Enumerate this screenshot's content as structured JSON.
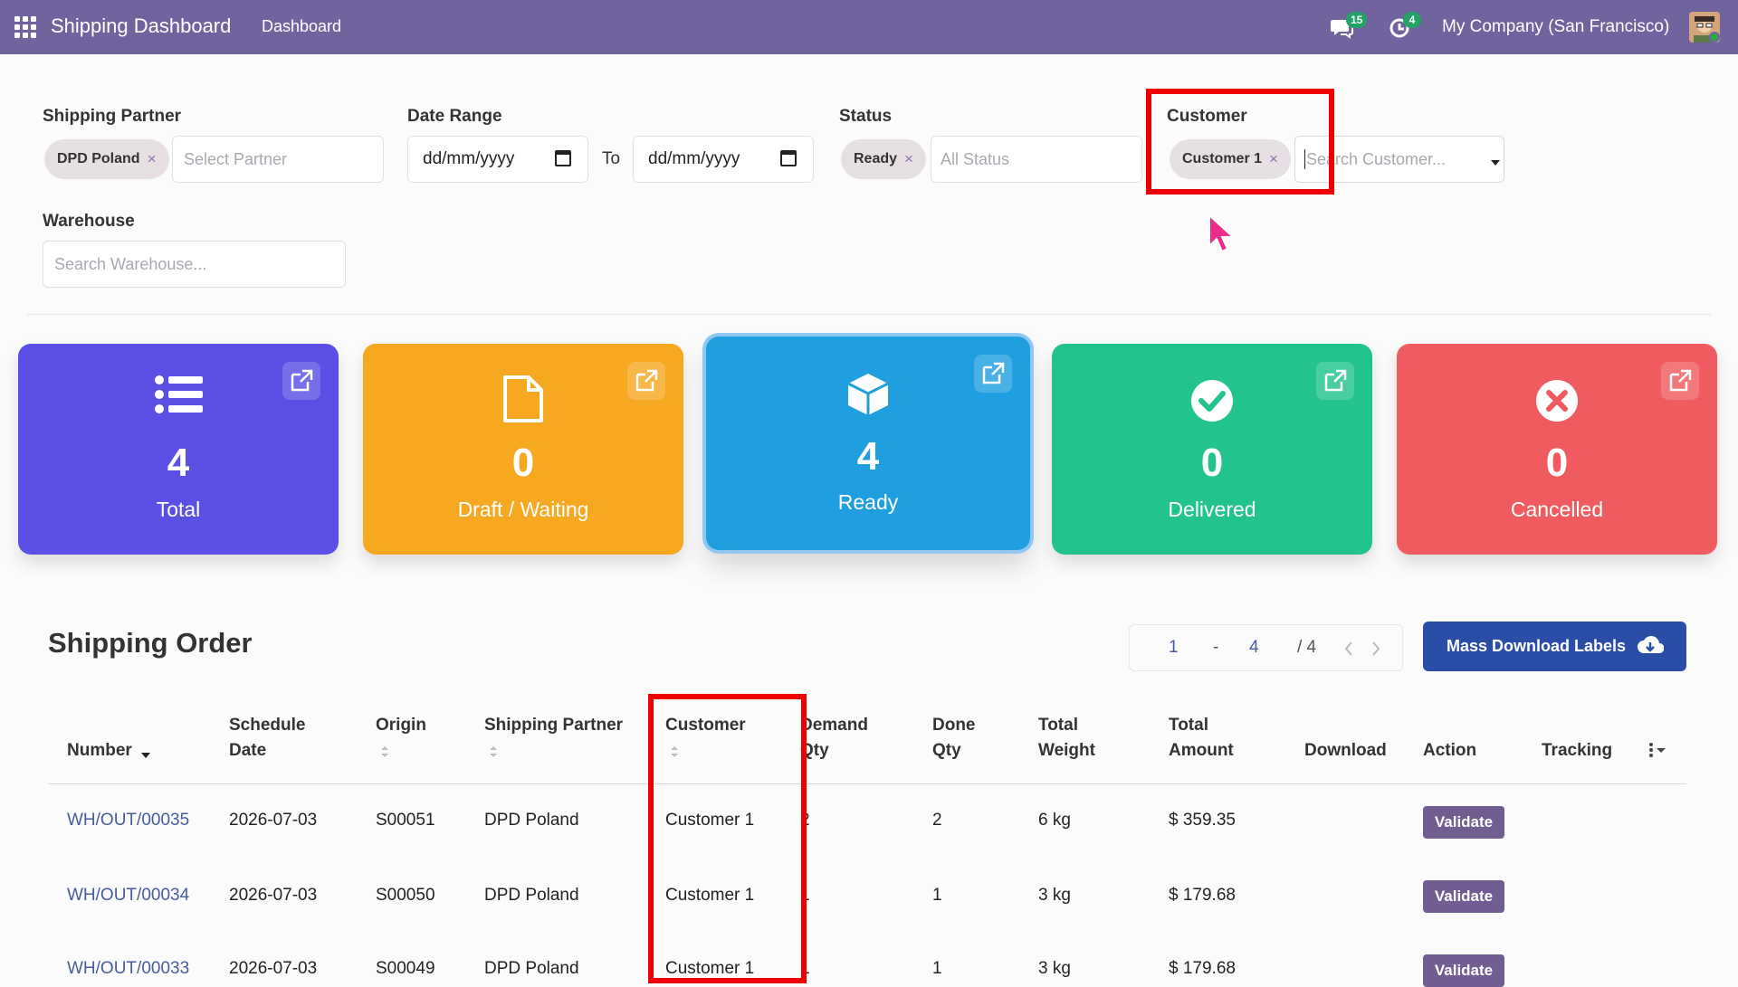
{
  "navbar": {
    "app_title": "Shipping Dashboard",
    "menu": [
      "Dashboard"
    ],
    "messages_count": "15",
    "activities_count": "4",
    "company": "My Company (San Francisco)",
    "colors": {
      "bar": "#71639e",
      "badge": "#21a366"
    }
  },
  "filters": {
    "shipping_partner": {
      "label": "Shipping Partner",
      "tag": "DPD Poland",
      "placeholder": "Select Partner"
    },
    "date_range": {
      "label": "Date Range",
      "from": "dd/mm/yyyy",
      "to_label": "To",
      "to": "dd/mm/yyyy"
    },
    "status": {
      "label": "Status",
      "tag": "Ready",
      "placeholder": "All Status"
    },
    "customer": {
      "label": "Customer",
      "tag": "Customer 1",
      "placeholder": "Search Customer..."
    },
    "warehouse": {
      "label": "Warehouse",
      "placeholder": "Search Warehouse..."
    },
    "tag_remove_glyph": "×"
  },
  "cards": [
    {
      "value": "4",
      "label": "Total",
      "icon": "list-icon",
      "color": "#5a50e6"
    },
    {
      "value": "0",
      "label": "Draft / Waiting",
      "icon": "file-icon",
      "color": "#f6a821"
    },
    {
      "value": "4",
      "label": "Ready",
      "icon": "cube-icon",
      "color": "#1f9fe0"
    },
    {
      "value": "0",
      "label": "Delivered",
      "icon": "check-circle-icon",
      "color": "#22c48c"
    },
    {
      "value": "0",
      "label": "Cancelled",
      "icon": "times-circle-icon",
      "color": "#ef5b5e"
    }
  ],
  "orders": {
    "title": "Shipping Order",
    "pager": {
      "start": "1",
      "sep": "-",
      "end": "4",
      "total": "/ 4"
    },
    "mass_download_label": "Mass Download Labels",
    "columns": [
      "Number",
      "Schedule Date",
      "Origin",
      "Shipping Partner",
      "Customer",
      "Demand Qty",
      "Done Qty",
      "Total Weight",
      "Total Amount",
      "Download",
      "Action",
      "Tracking"
    ],
    "rows": [
      {
        "number": "WH/OUT/00035",
        "date": "2026-07-03",
        "origin": "S00051",
        "partner": "DPD Poland",
        "customer": "Customer 1",
        "demand": "2",
        "done": "2",
        "weight": "6 kg",
        "amount": "$ 359.35",
        "action": "Validate"
      },
      {
        "number": "WH/OUT/00034",
        "date": "2026-07-03",
        "origin": "S00050",
        "partner": "DPD Poland",
        "customer": "Customer 1",
        "demand": "1",
        "done": "1",
        "weight": "3 kg",
        "amount": "$ 179.68",
        "action": "Validate"
      },
      {
        "number": "WH/OUT/00033",
        "date": "2026-07-03",
        "origin": "S00049",
        "partner": "DPD Poland",
        "customer": "Customer 1",
        "demand": "1",
        "done": "1",
        "weight": "3 kg",
        "amount": "$ 179.68",
        "action": "Validate"
      }
    ]
  }
}
